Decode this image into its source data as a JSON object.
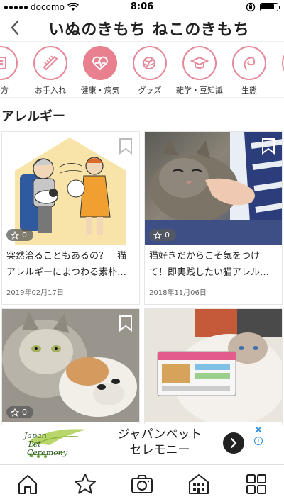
{
  "status_bar": {
    "carrier": "docomo",
    "time": "8:06"
  },
  "header": {
    "title": "いぬのきもち ねこのきもち",
    "back_icon": "chevron-left-icon"
  },
  "categories": [
    {
      "label": "い方",
      "icon": "book-icon",
      "active": false
    },
    {
      "label": "お手入れ",
      "icon": "comb-icon",
      "active": false
    },
    {
      "label": "健康・病気",
      "icon": "heart-pulse-icon",
      "active": true
    },
    {
      "label": "グッズ",
      "icon": "yarn-ball-icon",
      "active": false
    },
    {
      "label": "雑学・豆知識",
      "icon": "graduation-cap-icon",
      "active": false
    },
    {
      "label": "生態",
      "icon": "cat-tail-icon",
      "active": false
    }
  ],
  "section": {
    "title": "アレルギー"
  },
  "articles": [
    {
      "likes": "0",
      "title": "突然治ることもあるの？　猫アレルギーにまつわる素朴…",
      "date": "2019年02月17日"
    },
    {
      "likes": "0",
      "title": "猫好きだからこそ気をつけて！即実践したい猫アレル…",
      "date": "2018年11月06日"
    },
    {
      "likes": "0",
      "title": "",
      "date": ""
    },
    {
      "likes": "",
      "title": "",
      "date": ""
    }
  ],
  "ad": {
    "logo_text_1": "Japan",
    "logo_text_2": "Pet",
    "logo_text_3": "Ceremony",
    "line1": "ジャパンペット",
    "line2": "セレモニー",
    "go_icon": "chevron-right-icon",
    "close_icon": "close-icon",
    "info_icon": "info-icon"
  },
  "bottom_nav": [
    {
      "icon": "home-icon"
    },
    {
      "icon": "star-icon"
    },
    {
      "icon": "camera-icon"
    },
    {
      "icon": "building-icon"
    },
    {
      "icon": "grid-icon"
    }
  ],
  "colors": {
    "accent_pink": "#e8808f",
    "ad_blue": "#2a8bd8"
  }
}
